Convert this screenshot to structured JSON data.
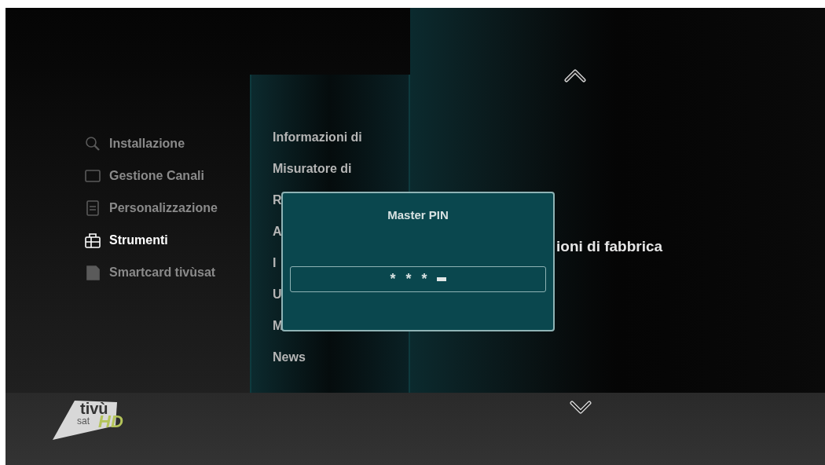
{
  "menu": {
    "items": [
      {
        "label": "Installazione",
        "kind": "search",
        "selected": false
      },
      {
        "label": "Gestione Canali",
        "kind": "tv",
        "selected": false
      },
      {
        "label": "Personalizzazione",
        "kind": "list",
        "selected": false
      },
      {
        "label": "Strumenti",
        "kind": "toolbox",
        "selected": true
      },
      {
        "label": "Smartcard tivùsat",
        "kind": "card",
        "selected": false
      }
    ]
  },
  "submenu": {
    "items": [
      "Informazioni di",
      "Misuratore di",
      "R",
      "A",
      "I",
      "U",
      "M",
      "News"
    ]
  },
  "detail": {
    "text": "ioni di fabbrica"
  },
  "dialog": {
    "title": "Master PIN",
    "pin_field": {
      "value": "* * *"
    }
  },
  "logo": {
    "brand": "tivù",
    "sub": "sat",
    "badge": "HD"
  }
}
